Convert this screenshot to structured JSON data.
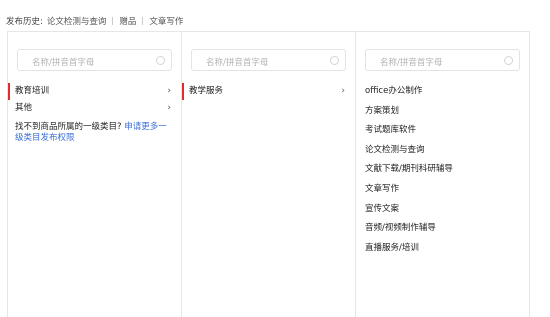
{
  "history": {
    "label": "发布历史:",
    "items": [
      "论文检测与查询",
      "赠品",
      "文章写作"
    ]
  },
  "columns": [
    {
      "search_placeholder": "名称/拼音首字母",
      "items": [
        {
          "label": "教育培训",
          "has_children": true,
          "active": true
        },
        {
          "label": "其他",
          "has_children": true,
          "active": false
        }
      ],
      "notice": {
        "text": "找不到商品所属的一级类目?",
        "link": "申请更多一级类目发布权限"
      }
    },
    {
      "search_placeholder": "名称/拼音首字母",
      "items": [
        {
          "label": "教学服务",
          "has_children": true,
          "active": true
        }
      ]
    },
    {
      "search_placeholder": "名称/拼音首字母",
      "items": [
        {
          "label": "office办公制作"
        },
        {
          "label": "方案策划"
        },
        {
          "label": "考试题库软件"
        },
        {
          "label": "论文检测与查询"
        },
        {
          "label": "文献下载/期刊科研辅导"
        },
        {
          "label": "文章写作"
        },
        {
          "label": "宣传文案"
        },
        {
          "label": "音频/视频制作辅导"
        },
        {
          "label": "直播服务/培训"
        }
      ]
    }
  ],
  "icons": {
    "chevron": "chevron-right-icon",
    "search": "search-icon"
  },
  "colors": {
    "accent": "#e22b2b",
    "link": "#3b6fd6",
    "border": "#e6e6e6"
  }
}
